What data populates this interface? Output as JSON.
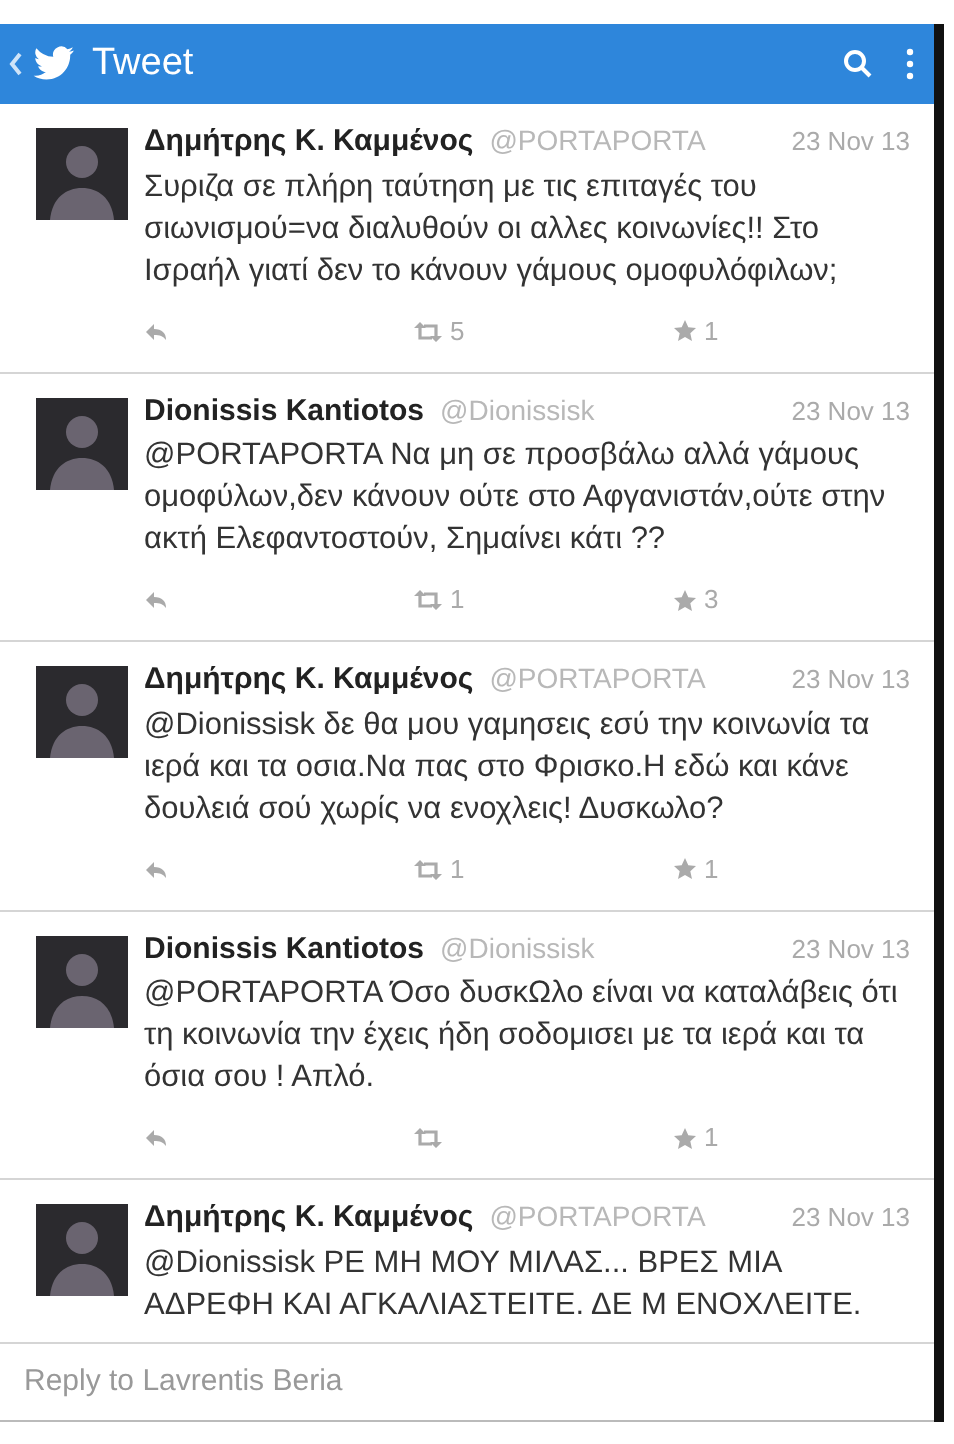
{
  "header": {
    "title": "Tweet"
  },
  "tweets": [
    {
      "name": "Δημήτρης Κ. Καμμένος",
      "handle": "@PORTAPORTA",
      "date": "23 Nov 13",
      "text": "Συριζα σε πλήρη ταύτηση με τις επιταγές του σιωνισμού=να διαλυθούν οι αλλες κοινωνίες!! Στο Ισραήλ γιατί δεν το κάνουν γάμους ομοφυλόφιλων;",
      "retweets": "5",
      "favorites": "1"
    },
    {
      "name": "Dionissis Kantiotos",
      "handle": "@Dionissisk",
      "date": "23 Nov 13",
      "text": "@PORTAPORTA Να μη σε προσβάλω αλλά γάμους ομοφύλων,δεν κάνουν ούτε στο Αφγανιστάν,ούτε στην ακτή Ελεφαντοστούν, Σημαίνει κάτι ??",
      "retweets": "1",
      "favorites": "3"
    },
    {
      "name": "Δημήτρης Κ. Καμμένος",
      "handle": "@PORTAPORTA",
      "date": "23 Nov 13",
      "text": "@Dionissisk δε θα μου γαμησεις εσύ την κοινωνία τα ιερά και τα οσια.Να πας στο Φρισκο.Η εδώ και κάνε δουλειά σού χωρίς να ενοχλεις! Δυσκωλο?",
      "retweets": "1",
      "favorites": "1"
    },
    {
      "name": "Dionissis Kantiotos",
      "handle": "@Dionissisk",
      "date": "23 Nov 13",
      "text": "@PORTAPORTA Όσο δυσκΩλο είναι να καταλάβεις ότι τη κοινωνία την έχεις ήδη σοδομισει με τα ιερά και τα όσια σου ! Απλό.",
      "favorites": "1"
    },
    {
      "name": "Δημήτρης Κ. Καμμένος",
      "handle": "@PORTAPORTA",
      "date": "23 Nov 13",
      "text": "@Dionissisk ΡΕ ΜΗ ΜΟΥ ΜΙΛΑΣ... ΒΡΕΣ ΜΙΑ ΑΔΡΕΦΗ ΚΑΙ ΑΓΚΑΛΙΑΣΤΕΙΤΕ. ΔΕ Μ ΕΝΟΧΛΕΙΤΕ."
    }
  ],
  "reply": {
    "placeholder": "Reply to Lavrentis Beria"
  }
}
